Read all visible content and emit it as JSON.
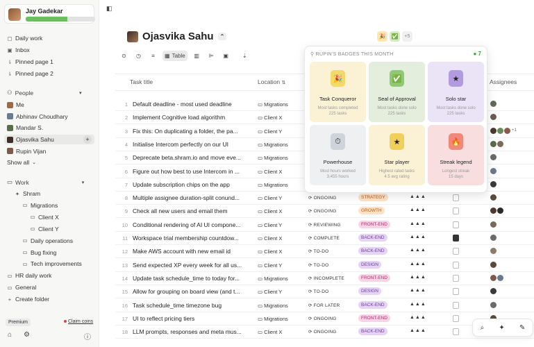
{
  "user": {
    "name": "Jay Gadekar",
    "xp_progress": 0.6
  },
  "sidebar": {
    "top": [
      {
        "icon": "calendar-icon",
        "glyph": "▢",
        "label": "Daily work"
      },
      {
        "icon": "inbox-icon",
        "glyph": "▣",
        "label": "Inbox"
      },
      {
        "icon": "pin-icon",
        "glyph": "⇂",
        "label": "Pinned page 1"
      },
      {
        "icon": "pin-icon",
        "glyph": "⇂",
        "label": "Pinned page 2"
      }
    ],
    "people_header": "People",
    "people": [
      {
        "label": "Me",
        "color": "#9a6b4a"
      },
      {
        "label": "Abhinav Choudhary",
        "color": "#6a7b8f"
      },
      {
        "label": "Mandar S.",
        "color": "#5b6e4c"
      },
      {
        "label": "Ojasvika Sahu",
        "color": "#3b2f2a",
        "active": true
      },
      {
        "label": "Rupin Vijan",
        "color": "#7a5b4a"
      }
    ],
    "add_person": "+",
    "show_all": "Show all",
    "work_header": "Work",
    "work": [
      {
        "label": "Shram",
        "indent": 1,
        "glyph": "✦"
      },
      {
        "label": "Migrations",
        "indent": 2,
        "glyph": "▭"
      },
      {
        "label": "Client X",
        "indent": 3,
        "glyph": "▭"
      },
      {
        "label": "Client Y",
        "indent": 3,
        "glyph": "▭"
      },
      {
        "label": "Daily operations",
        "indent": 2,
        "glyph": "▭"
      },
      {
        "label": "Bug fixing",
        "indent": 2,
        "glyph": "▭"
      },
      {
        "label": "Tech improvements",
        "indent": 2,
        "glyph": "▭"
      },
      {
        "label": "HR daily work",
        "indent": 0,
        "glyph": "▭"
      },
      {
        "label": "General",
        "indent": 0,
        "glyph": "▭"
      },
      {
        "label": "Create folder",
        "indent": 0,
        "glyph": "+"
      }
    ],
    "premium": "Premium",
    "claim": "Claim coins"
  },
  "page": {
    "title": "Ojasvika Sahu",
    "extra_badges": "+5",
    "view_label": "Table"
  },
  "columns": {
    "task": "Task title",
    "location": "Location",
    "assignees": "Assignees"
  },
  "tasks": [
    {
      "n": "1",
      "title": "Default deadline - most used deadline",
      "loc": "Migrations",
      "status": "",
      "tag": "",
      "tagcolor": "",
      "prio": "",
      "flag": "",
      "ass": [
        "#5d6b57"
      ]
    },
    {
      "n": "2",
      "title": "Implement Cognitive load algorithm",
      "loc": "Client X",
      "status": "",
      "tag": "",
      "tagcolor": "",
      "prio": "",
      "flag": "",
      "ass": [
        "#6a5d50"
      ]
    },
    {
      "n": "3",
      "title": "Fix this: On duplicating a folder, the pa...",
      "loc": "Client Y",
      "status": "",
      "tag": "",
      "tagcolor": "",
      "prio": "",
      "flag": "",
      "ass": [
        "#4a3a30",
        "#6b8a5a",
        "#8a5a4a"
      ],
      "more": "+1"
    },
    {
      "n": "4",
      "title": "Initialise Intercom perfectly on our UI",
      "loc": "Migrations",
      "status": "",
      "tag": "",
      "tagcolor": "",
      "prio": "",
      "flag": "",
      "ass": [
        "#5a6a4a",
        "#7a6a5a"
      ]
    },
    {
      "n": "5",
      "title": "Deprecate beta.shram.io and move eve...",
      "loc": "Migrations",
      "status": "",
      "tag": "",
      "tagcolor": "",
      "prio": "",
      "flag": "",
      "ass": [
        "#6a6a6a"
      ]
    },
    {
      "n": "6",
      "title": "Figure out how best to use Intercom in ...",
      "loc": "Client X",
      "status": "",
      "tag": "",
      "tagcolor": "",
      "prio": "",
      "flag": "",
      "ass": [
        "#6a7a8a"
      ]
    },
    {
      "n": "7",
      "title": "Update subscription chips on the app",
      "loc": "Migrations",
      "status": "",
      "tag": "",
      "tagcolor": "",
      "prio": "",
      "flag": "",
      "ass": [
        "#3a3a3a"
      ]
    },
    {
      "n": "8",
      "title": "Multiple assignee duration-split conund...",
      "loc": "Client Y",
      "status": "ONGOING",
      "tag": "STRATEGY",
      "tagcolor": "orange",
      "prio": "▲▲▲",
      "flag": "",
      "ass": [
        "#5a4a3a"
      ]
    },
    {
      "n": "9",
      "title": "Check all new users and email them",
      "loc": "Client X",
      "status": "ONGOING",
      "tag": "GROWTH",
      "tagcolor": "orange",
      "prio": "▲▲▲",
      "flag": "",
      "ass": [
        "#4a3a30",
        "#2a2a2a"
      ]
    },
    {
      "n": "10",
      "title": "Conditional rendering of AI UI compone...",
      "loc": "Client Y",
      "status": "REVIEWING",
      "tag": "FRONT-END",
      "tagcolor": "pink",
      "prio": "▲▲▲",
      "flag": "",
      "ass": [
        "#7a6a5a"
      ]
    },
    {
      "n": "11",
      "title": "Workspace trial membership countdow...",
      "loc": "Client X",
      "status": "COMPLETE",
      "tag": "BACK-END",
      "tagcolor": "purple",
      "prio": "▲▲▲",
      "flag": "dark",
      "ass": [
        "#6a6a6a"
      ]
    },
    {
      "n": "12",
      "title": "Make AWS account with new email id",
      "loc": "Client X",
      "status": "TO-DO",
      "tag": "BACK-END",
      "tagcolor": "purple",
      "prio": "▲▲▲",
      "flag": "",
      "ass": [
        "#8a7a6a"
      ]
    },
    {
      "n": "13",
      "title": "Send expected XP every week for all us...",
      "loc": "Client Y",
      "status": "TO-DO",
      "tag": "DESIGN",
      "tagcolor": "purple",
      "prio": "▲▲▲",
      "flag": "",
      "ass": [
        "#5a4a3a"
      ]
    },
    {
      "n": "14",
      "title": "Update task schedule_time to today for...",
      "loc": "Migrations",
      "status": "INCOMPLETE",
      "tag": "FRONT-END",
      "tagcolor": "pink",
      "prio": "▲▲▲",
      "flag": "",
      "ass": [
        "#7a5a4a",
        "#6a7a8a"
      ]
    },
    {
      "n": "15",
      "title": "Allow for grouping on board view (and t...",
      "loc": "Client Y",
      "status": "TO-DO",
      "tag": "DESIGN",
      "tagcolor": "purple",
      "prio": "▲▲▲",
      "flag": "",
      "ass": [
        "#3a3a3a"
      ]
    },
    {
      "n": "16",
      "title": "Task schedule_time timezone bug",
      "loc": "Migrations",
      "status": "FOR LATER",
      "tag": "BACK-END",
      "tagcolor": "purple",
      "prio": "▲▲▲",
      "flag": "",
      "ass": [
        "#6a6a6a"
      ]
    },
    {
      "n": "17",
      "title": "UI to reflect pricing tiers",
      "loc": "Migrations",
      "status": "ONGOING",
      "tag": "FRONT-END",
      "tagcolor": "pink",
      "prio": "▲▲▲",
      "flag": "",
      "ass": [
        "#5a4a3a"
      ]
    },
    {
      "n": "18",
      "title": "LLM prompts, responses and meta mus...",
      "loc": "Client X",
      "status": "ONGOING",
      "tag": "BACK-END",
      "tagcolor": "purple",
      "prio": "▲▲▲",
      "flag": "",
      "ass": [
        "#8a7a6a"
      ]
    }
  ],
  "popup": {
    "header": "RUPIN'S BADGES THIS MONTH",
    "count": "7",
    "badges": [
      {
        "title": "Task Conqueror",
        "d1": "Most tasks completed",
        "d2": "225 tasks",
        "bg": "#fbf1d4",
        "emb": "#f3d86a",
        "glyph": "🎉"
      },
      {
        "title": "Seal of Approval",
        "d1": "Most tasks done solo",
        "d2": "225 tasks",
        "bg": "#e3eedc",
        "emb": "#8fca72",
        "glyph": "✅"
      },
      {
        "title": "Solo star",
        "d1": "Most tasks done solo",
        "d2": "225 tasks",
        "bg": "#ebe4f7",
        "emb": "#b39be0",
        "glyph": "★"
      },
      {
        "title": "Powerhouse",
        "d1": "Most hours worked",
        "d2": "3,455 hours",
        "bg": "#eef0f2",
        "emb": "#cfd4da",
        "glyph": "⏱"
      },
      {
        "title": "Star player",
        "d1": "Highest rated tasks",
        "d2": "4.5 avg rating",
        "bg": "#fbf1d4",
        "emb": "#f0cf5a",
        "glyph": "★"
      },
      {
        "title": "Streak legend",
        "d1": "Longest streak",
        "d2": "15 days",
        "bg": "#f8dede",
        "emb": "#ef8a7a",
        "glyph": "🔥"
      }
    ]
  }
}
